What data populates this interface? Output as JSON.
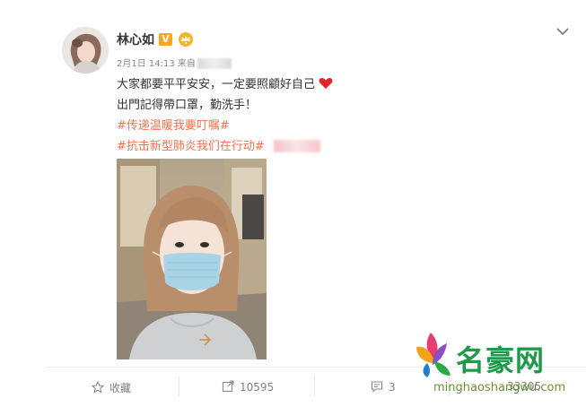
{
  "user": {
    "name": "林心如",
    "verified_badge": "V",
    "icons": [
      "avatar",
      "verified-icon",
      "crown-icon"
    ]
  },
  "post": {
    "meta": "2月1日 14:13 来自",
    "line1": "大家都要平平安安，一定要照顧好自己",
    "line2": "出門記得帶口罩，勤洗手！",
    "hashtags": [
      "#传递温暖我要叮嘱#",
      "#抗击新型肺炎我们在行动#"
    ]
  },
  "actions": {
    "favorite": {
      "label": "收藏"
    },
    "repost": {
      "count": "10595"
    },
    "comment": {
      "count": "3"
    },
    "like": {
      "count": "33305"
    }
  },
  "watermark": {
    "name": "名豪网",
    "url": "minghaoshangwu.com"
  },
  "colors": {
    "hashtag": "#eb7350",
    "heart": "#e0242e",
    "badge": "#f5a623",
    "watermark": "#1e9a4a"
  }
}
